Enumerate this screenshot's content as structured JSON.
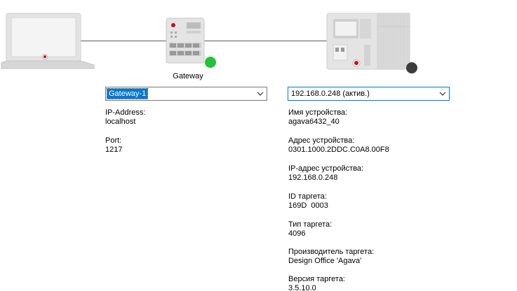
{
  "topology": {
    "gateway_label": "Gateway",
    "gateway_status_color": "#22c33a",
    "device_status_color": "#3c3c3c"
  },
  "gateway_panel": {
    "selector_value": "Gateway-1",
    "ip_label": "IP-Address:",
    "ip_value": "localhost",
    "port_label": "Port:",
    "port_value": "1217"
  },
  "device_panel": {
    "selector_value": "192.168.0.248 (актив.)",
    "properties": [
      {
        "label": "Имя устройства:",
        "value": "agava6432_40"
      },
      {
        "label": "Адрес устройства:",
        "value": "0301.1000.2DDC.C0A8.00F8"
      },
      {
        "label": "IP-адрес устройства:",
        "value": "192.168.0.248"
      },
      {
        "label": "ID таргета:",
        "value": "169D  0003"
      },
      {
        "label": "Тип таргета:",
        "value": "4096"
      },
      {
        "label": "Производитель таргета:",
        "value": "Design Office 'Agava'"
      },
      {
        "label": "Версия таргета:",
        "value": "3.5.10.0"
      }
    ]
  }
}
